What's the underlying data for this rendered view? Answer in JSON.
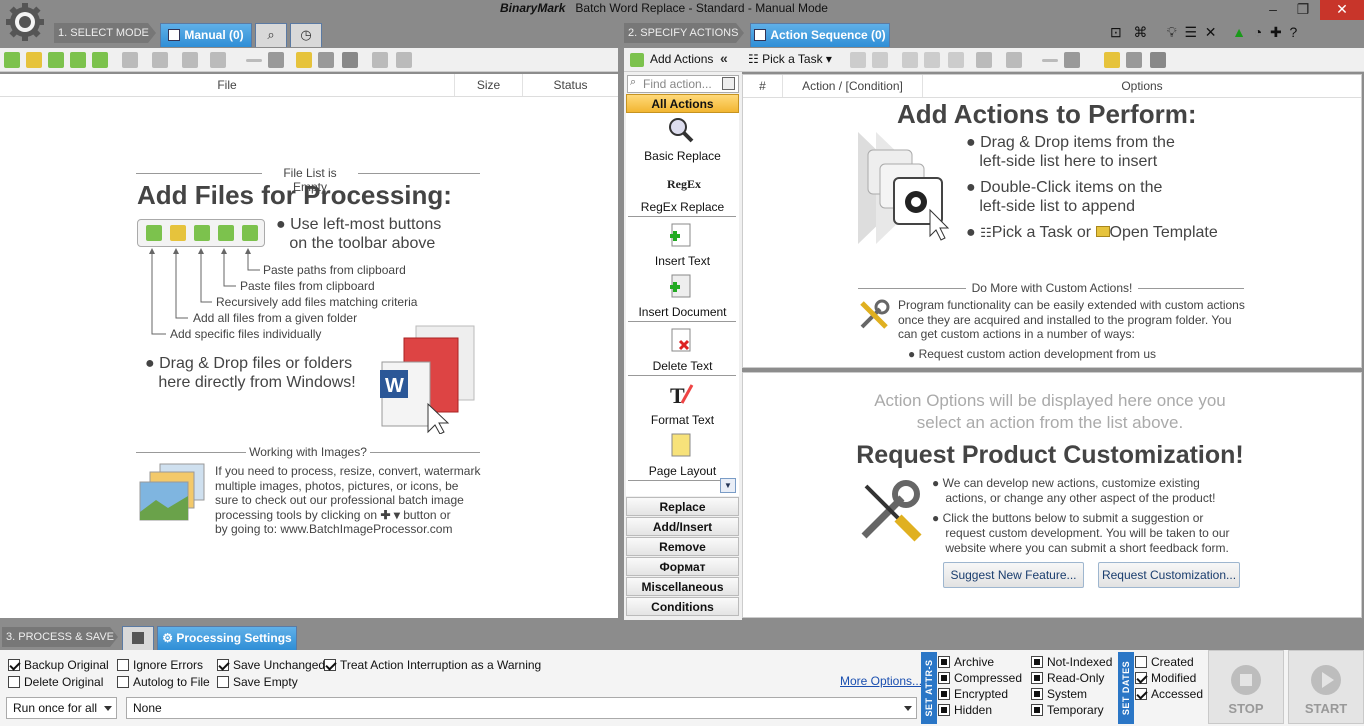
{
  "window": {
    "brand": "BinaryMark",
    "title": "Batch Word Replace - Standard - Manual Mode",
    "controls": {
      "minimize": "–",
      "maximize": "❐",
      "close": "✕"
    }
  },
  "left_tabs": {
    "step": "1. SELECT MODE",
    "manual": "Manual (0)"
  },
  "right_tabs": {
    "step": "2. SPECIFY ACTIONS",
    "sequence": "Action Sequence (0)"
  },
  "file_columns": [
    "File",
    "Size",
    "Status"
  ],
  "left_content": {
    "empty_label": "File List is Empty",
    "heading": "Add Files for Processing:",
    "bullet1_line1": "Use left-most buttons",
    "bullet1_line2": "on the toolbar above",
    "pointers": [
      "Paste paths from clipboard",
      "Paste files from clipboard",
      "Recursively add files matching criteria",
      "Add all files from a given folder",
      "Add specific files individually"
    ],
    "bullet2_line1": "Drag & Drop files or folders",
    "bullet2_line2": "here directly from Windows!",
    "images_label": "Working with Images?",
    "images_text": [
      "If you need to process, resize, convert, watermark",
      "multiple images, photos, pictures, or icons, be",
      "sure to check out our professional batch image",
      "processing tools by clicking on",
      "button or",
      "by going to: www.BatchImageProcessor.com"
    ]
  },
  "actions_panel": {
    "add_actions": "Add Actions",
    "collapse": "«",
    "search_placeholder": "Find action...",
    "all_actions": "All Actions",
    "items": [
      "Basic Replace",
      "RegEx Replace",
      "Insert Text",
      "Insert Document",
      "Delete Text",
      "Format Text",
      "Page Layout"
    ],
    "regex_logo": "RegEx",
    "categories": [
      "Replace",
      "Add/Insert",
      "Remove",
      "Формат",
      "Miscellaneous",
      "Conditions"
    ]
  },
  "sequence_toolbar": {
    "pick_task": "Pick a Task"
  },
  "sequence_columns": [
    "#",
    "Action / [Condition]",
    "Options"
  ],
  "sequence_content": {
    "heading": "Add Actions to Perform:",
    "b1_line1": "Drag & Drop items from the",
    "b1_line2": "left-side list here to insert",
    "b2_line1": "Double-Click items on the",
    "b2_line2": "left-side list to append",
    "b3_part1": "Pick a Task or",
    "b3_part2": "Open Template",
    "custom_label": "Do More with Custom Actions!",
    "custom_text": [
      "Program functionality can be easily extended with custom actions",
      "once they are acquired and installed to the program folder. You",
      "can get custom actions in a number of ways:"
    ],
    "custom_bullet": "Request custom action development from us"
  },
  "options_content": {
    "placeholder_line1": "Action Options will be displayed here once you",
    "placeholder_line2": "select an action from the list above.",
    "heading": "Request Product Customization!",
    "b1": [
      "We can develop new actions, customize existing",
      "actions, or change any other aspect of the product!"
    ],
    "b2": [
      "Click the buttons below to submit a suggestion or",
      "request custom development. You will be taken to our",
      "website where you can submit a short feedback form."
    ],
    "suggest_btn": "Suggest New Feature...",
    "request_btn": "Request Customization..."
  },
  "bottom": {
    "step": "3. PROCESS & SAVE",
    "settings_tab": "Processing Settings",
    "checks": [
      {
        "label": "Backup Original",
        "checked": true
      },
      {
        "label": "Delete Original",
        "checked": false
      },
      {
        "label": "Ignore Errors",
        "checked": false
      },
      {
        "label": "Autolog to File",
        "checked": false
      },
      {
        "label": "Save Unchanged",
        "checked": true
      },
      {
        "label": "Save Empty",
        "checked": false
      },
      {
        "label": "Treat Action Interruption as a Warning",
        "checked": true
      }
    ],
    "more_options": "More Options...",
    "run_mode": "Run once for all",
    "schedule": "None",
    "attr_label": "SET ATTR-S",
    "attrs": [
      "Archive",
      "Compressed",
      "Encrypted",
      "Hidden",
      "Not-Indexed",
      "Read-Only",
      "System",
      "Temporary"
    ],
    "dates_label": "SET DATES",
    "dates": [
      {
        "label": "Created",
        "checked": false
      },
      {
        "label": "Modified",
        "checked": true
      },
      {
        "label": "Accessed",
        "checked": true
      }
    ],
    "stop": "STOP",
    "start": "START"
  }
}
